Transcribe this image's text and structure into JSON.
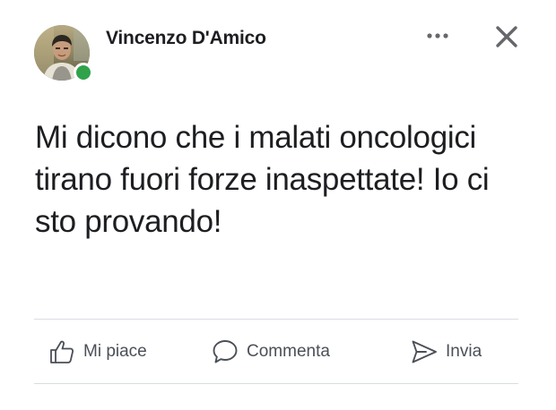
{
  "post": {
    "author": "Vincenzo D'Amico",
    "online": true,
    "text": "Mi dicono che i malati oncologici tirano fuori forze inaspettate! Io ci sto provando!"
  },
  "header": {
    "more_icon": "more-horizontal-icon",
    "close_icon": "close-icon"
  },
  "actions": {
    "like_label": "Mi piace",
    "comment_label": "Commenta",
    "send_label": "Invia",
    "like_icon": "thumbs-up-icon",
    "comment_icon": "comment-bubble-icon",
    "send_icon": "send-arrow-icon"
  },
  "colors": {
    "online": "#31a24c",
    "text": "#1c1e21",
    "action_text": "#4b4f56",
    "divider": "#dadde1"
  }
}
